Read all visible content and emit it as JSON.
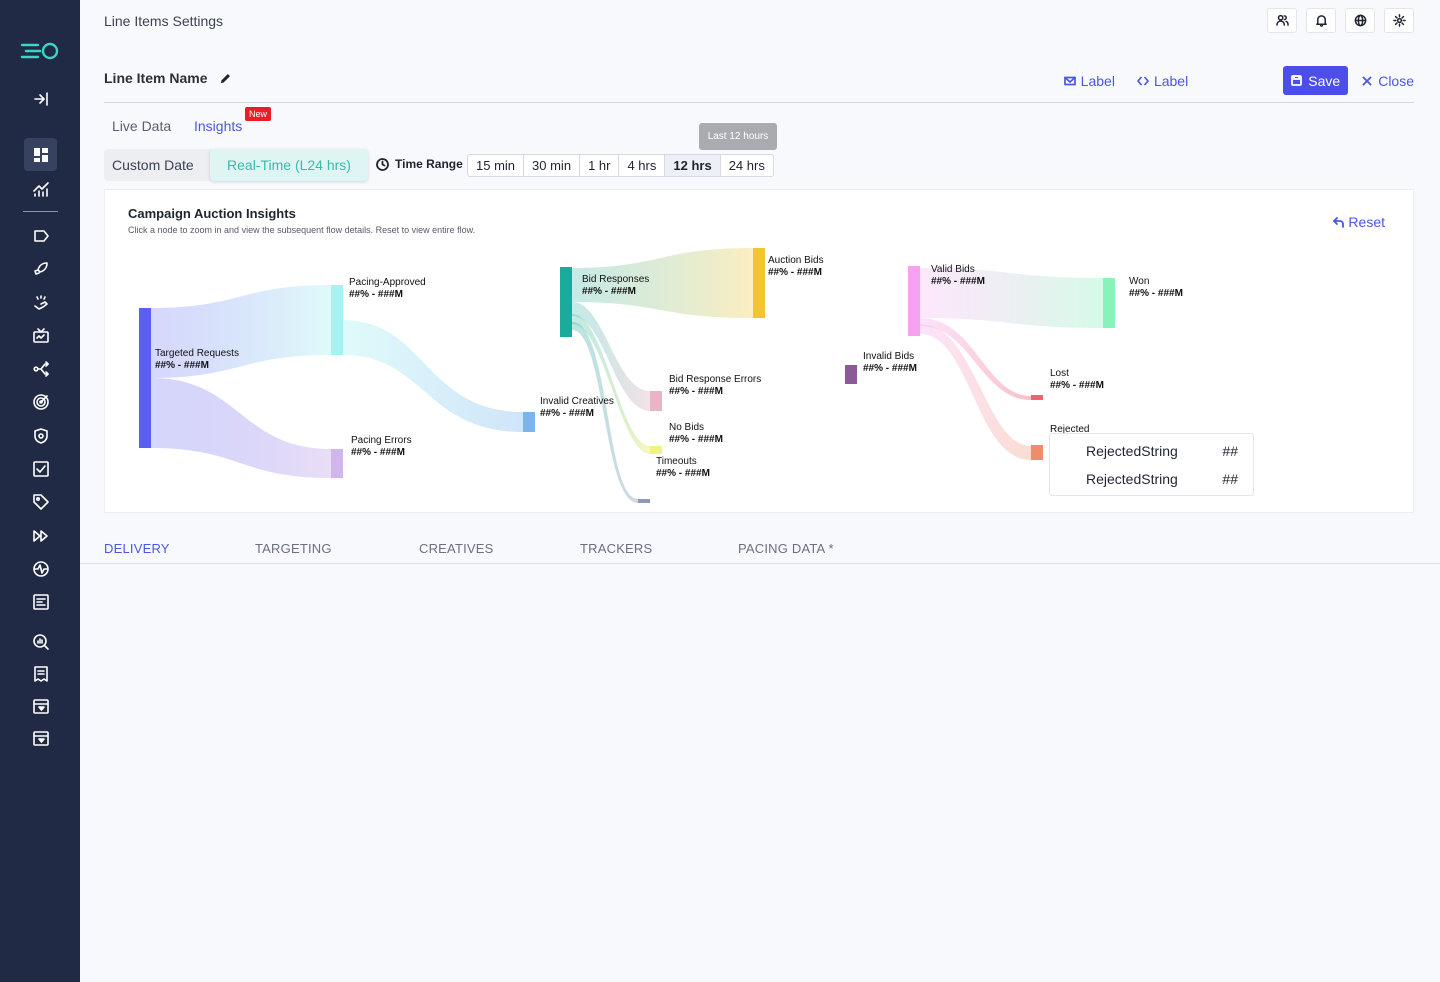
{
  "header": {
    "page_title": "Line Items Settings",
    "line_item_name": "Line Item Name",
    "label_1": "Label",
    "label_2": "Label",
    "save": "Save",
    "close": "Close"
  },
  "sidebar": {
    "items": [
      "logo-icon",
      "collapse-icon",
      "dashboard-icon",
      "analytics-icon",
      "label-icon",
      "rocket-icon",
      "hands-icon",
      "tv-icon",
      "share-icon",
      "target-icon",
      "shield-icon",
      "checkbox-icon",
      "tag-icon",
      "fast-forward-icon",
      "pulse-icon",
      "report-icon",
      "search-chart-icon",
      "receipt-icon",
      "store-icon",
      "store-alt-icon"
    ]
  },
  "tabs": {
    "live": "Live Data",
    "insights": "Insights",
    "badge": "New"
  },
  "controls": {
    "custom_date": "Custom Date",
    "realtime": "Real-Time (L24 hrs)",
    "time_range": "Time Range",
    "ranges": [
      "15 min",
      "30 min",
      "1 hr",
      "4 hrs",
      "12 hrs",
      "24 hrs"
    ],
    "selected": "12 hrs",
    "tooltip": "Last 12 hours"
  },
  "card": {
    "title": "Campaign Auction Insights",
    "subtitle": "Click a node to zoom in and view the subsequent flow details. Reset to view entire flow.",
    "reset": "Reset"
  },
  "sankey": {
    "nodes": [
      {
        "id": "targeted",
        "label": "Targeted Requests",
        "value": "##% - ###M",
        "color": "#5a5ff2"
      },
      {
        "id": "pacing_approved",
        "label": "Pacing-Approved",
        "value": "##% - ###M",
        "color": "#a5f3f1"
      },
      {
        "id": "pacing_errors",
        "label": "Pacing Errors",
        "value": "##% - ###M",
        "color": "#d0b6ec"
      },
      {
        "id": "invalid_creatives",
        "label": "Invalid Creatives",
        "value": "##% - ###M",
        "color": "#7ab3ee"
      },
      {
        "id": "bid_responses",
        "label": "Bid Responses",
        "value": "##% - ###M",
        "color": "#1aab9c"
      },
      {
        "id": "auction_bids",
        "label": "Auction Bids",
        "value": "##% - ###M",
        "color": "#f2c531"
      },
      {
        "id": "bid_response_errors",
        "label": "Bid Response Errors",
        "value": "##% - ###M",
        "color": "#e8b5c7"
      },
      {
        "id": "no_bids",
        "label": "No Bids",
        "value": "##% - ###M",
        "color": "#f3f27a"
      },
      {
        "id": "timeouts",
        "label": "Timeouts",
        "value": "##% - ###M",
        "color": "#8f98b5"
      },
      {
        "id": "invalid_bids",
        "label": "Invalid Bids",
        "value": "##% - ###M",
        "color": "#8b5b96"
      },
      {
        "id": "valid_bids",
        "label": "Valid Bids",
        "value": "##% - ###M",
        "color": "#f7a2f1"
      },
      {
        "id": "won",
        "label": "Won",
        "value": "##% - ###M",
        "color": "#87f3bb"
      },
      {
        "id": "lost",
        "label": "Lost",
        "value": "##% - ###M",
        "color": "#ee6272"
      },
      {
        "id": "rejected",
        "label": "Rejected",
        "value": "",
        "color": "#ef8c6a"
      }
    ],
    "rejected_breakdown": [
      {
        "label": "RejectedString",
        "value": "##"
      },
      {
        "label": "RejectedString",
        "value": "##"
      }
    ]
  },
  "bottom_tabs": [
    "DELIVERY",
    "TARGETING",
    "CREATIVES",
    "TRACKERS",
    "PACING DATA *"
  ],
  "colors": {
    "accent": "#4b57e0",
    "sidebar_bg": "#202a44",
    "save_bg": "#4c4eec",
    "badge": "#ea1d25",
    "realtime": "#3cb9ab"
  }
}
